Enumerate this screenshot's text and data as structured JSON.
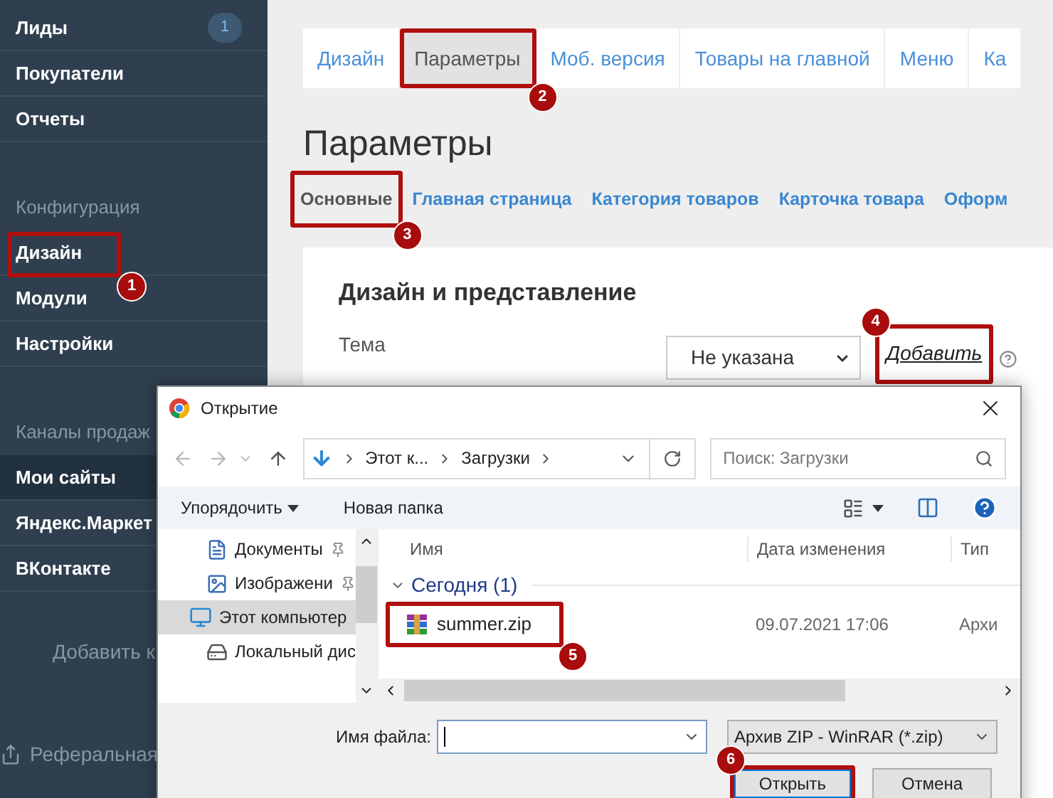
{
  "sidebar": {
    "items": [
      {
        "kind": "item",
        "label": "Лиды",
        "selected": false,
        "badge": "1"
      },
      {
        "kind": "item",
        "label": "Покупатели",
        "selected": false
      },
      {
        "kind": "item",
        "label": "Отчеты",
        "selected": false
      },
      {
        "kind": "header",
        "label": "Конфигурация"
      },
      {
        "kind": "item",
        "label": "Дизайн",
        "selected": false,
        "callout": "1"
      },
      {
        "kind": "item",
        "label": "Модули",
        "selected": false
      },
      {
        "kind": "item",
        "label": "Настройки",
        "selected": false
      },
      {
        "kind": "header",
        "label": "Каналы продаж"
      },
      {
        "kind": "item",
        "label": "Мои сайты",
        "selected": true
      },
      {
        "kind": "item",
        "label": "Яндекс.Маркет",
        "selected": false
      },
      {
        "kind": "item",
        "label": "ВКонтакте",
        "selected": false
      },
      {
        "kind": "action",
        "label": "Добавить к"
      },
      {
        "kind": "footer",
        "label": "Реферальная"
      }
    ]
  },
  "tabs": [
    {
      "label": "Дизайн",
      "selected": false
    },
    {
      "label": "Параметры",
      "selected": true,
      "callout": "2"
    },
    {
      "label": "Моб. версия",
      "selected": false
    },
    {
      "label": "Товары на главной",
      "selected": false
    },
    {
      "label": "Меню",
      "selected": false
    },
    {
      "label": "Ка",
      "selected": false
    }
  ],
  "page_title": "Параметры",
  "subtabs": [
    {
      "label": "Основные",
      "selected": true,
      "callout": "3"
    },
    {
      "label": "Главная страница",
      "selected": false
    },
    {
      "label": "Категория товаров",
      "selected": false
    },
    {
      "label": "Карточка товара",
      "selected": false
    },
    {
      "label": "Оформ",
      "selected": false
    }
  ],
  "card": {
    "title": "Дизайн и представление",
    "theme_label": "Тема",
    "theme_value": "Не указана",
    "add_link": "Добавить",
    "add_callout": "4"
  },
  "dialog": {
    "title": "Открытие",
    "path": [
      "Этот к...",
      "Загрузки"
    ],
    "search_placeholder": "Поиск: Загрузки",
    "toolbar": [
      "Упорядочить",
      "Новая папка"
    ],
    "nav": [
      {
        "label": "Документы",
        "kind": "documents",
        "pinned": true,
        "selected": false
      },
      {
        "label": "Изображени",
        "kind": "images",
        "pinned": true,
        "selected": false
      },
      {
        "label": "Этот компьютер",
        "kind": "computer",
        "pinned": false,
        "selected": true
      },
      {
        "label": "Локальный дис",
        "kind": "disk",
        "pinned": false,
        "selected": false
      }
    ],
    "columns": [
      "Имя",
      "Дата изменения",
      "Тип"
    ],
    "group": "Сегодня (1)",
    "files": [
      {
        "name": "summer.zip",
        "date": "09.07.2021 17:06",
        "type": "Архи",
        "callout": "5"
      }
    ],
    "filename_label": "Имя файла:",
    "filetype": "Архив ZIP - WinRAR (*.zip)",
    "buttons": [
      {
        "label": "Открыть",
        "default": true,
        "callout": "6"
      },
      {
        "label": "Отмена",
        "default": false
      }
    ]
  }
}
